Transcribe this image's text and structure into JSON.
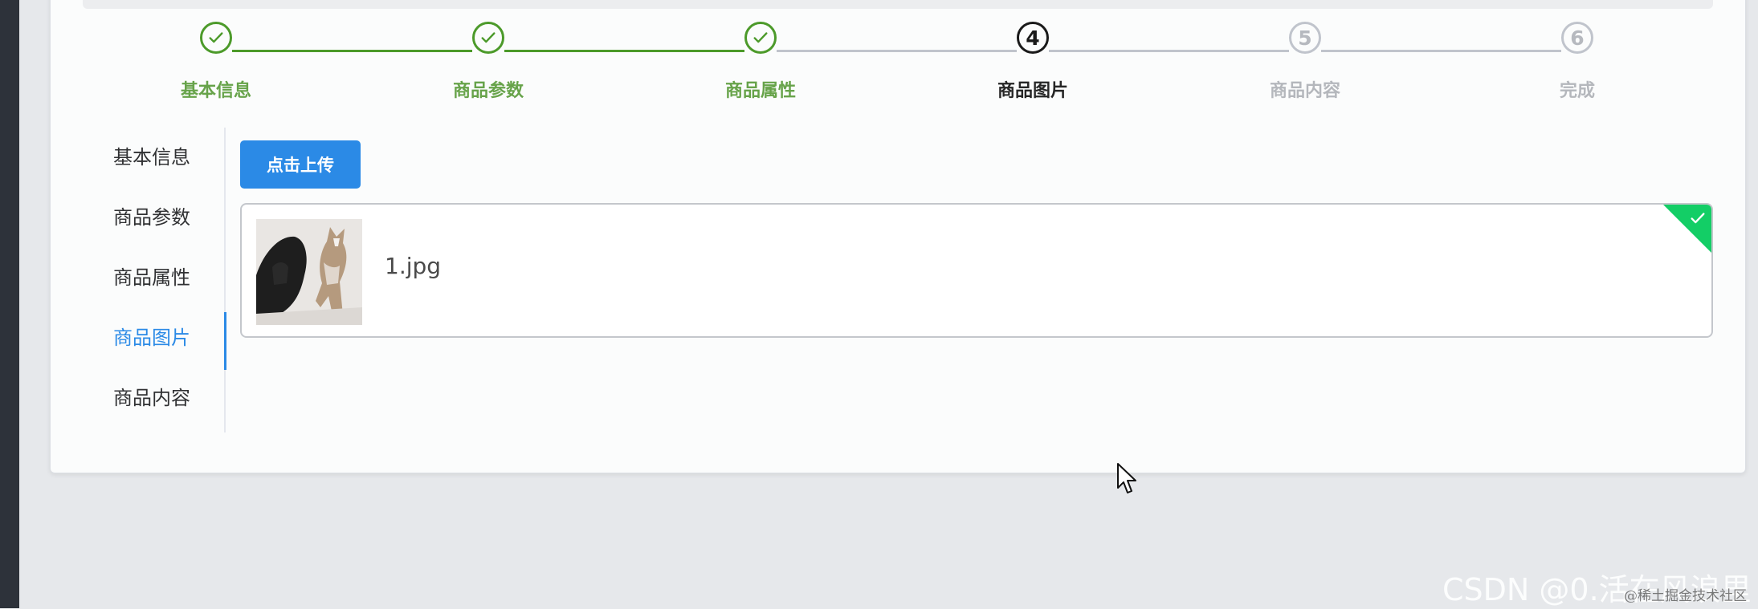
{
  "steps": [
    {
      "label": "基本信息",
      "status": "done"
    },
    {
      "label": "商品参数",
      "status": "done"
    },
    {
      "label": "商品属性",
      "status": "done"
    },
    {
      "label": "商品图片",
      "status": "process",
      "number": "4"
    },
    {
      "label": "商品内容",
      "status": "wait",
      "number": "5"
    },
    {
      "label": "完成",
      "status": "wait",
      "number": "6"
    }
  ],
  "tabs": [
    {
      "label": "基本信息",
      "active": false
    },
    {
      "label": "商品参数",
      "active": false
    },
    {
      "label": "商品属性",
      "active": false
    },
    {
      "label": "商品图片",
      "active": true
    },
    {
      "label": "商品内容",
      "active": false
    }
  ],
  "upload": {
    "button_label": "点击上传",
    "file_name": "1.jpg",
    "status_icon": "check-icon"
  },
  "watermark": {
    "text": "CSDN @0.活在风浪里",
    "secondary": "@稀土掘金技术社区"
  },
  "colors": {
    "done": "#4c9a2a",
    "process": "#1a1a1a",
    "wait": "#c0c4cc",
    "primary": "#2b8ae6",
    "success": "#13ce66"
  }
}
